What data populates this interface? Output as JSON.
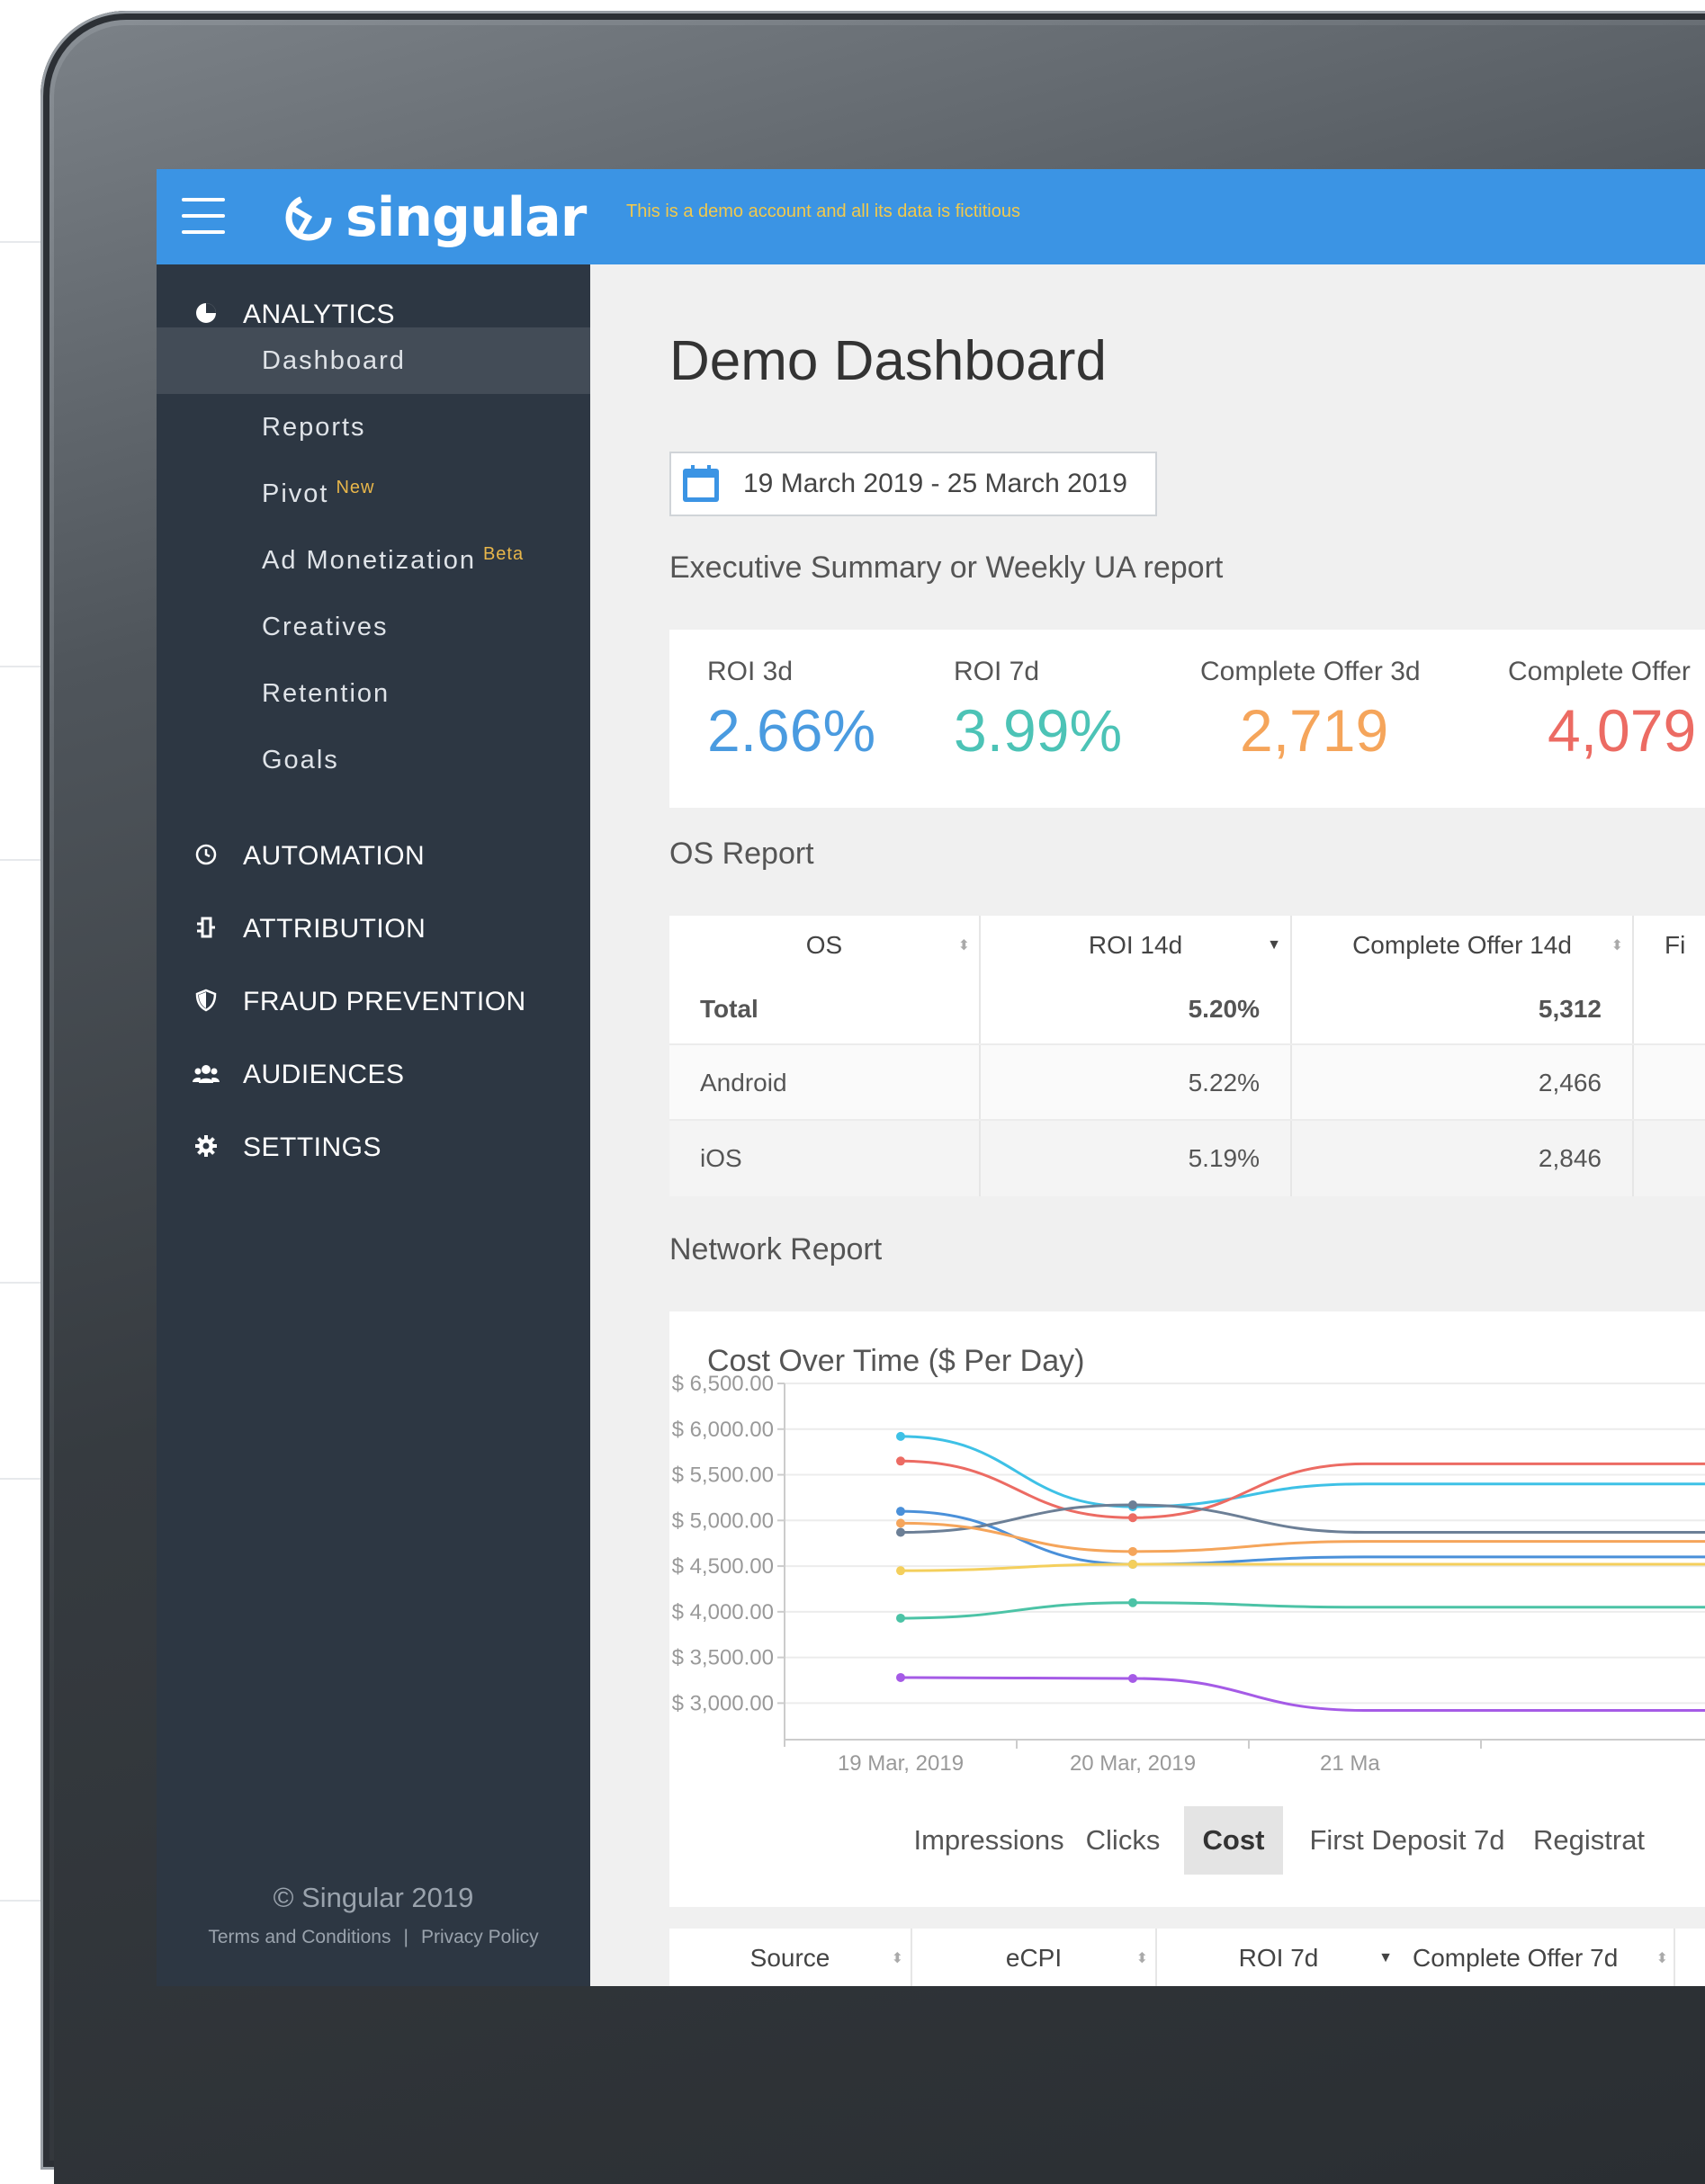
{
  "topbar": {
    "logo_text": "singular",
    "demo_note": "This is a demo account and all its data is fictitious"
  },
  "sidebar": {
    "sections": [
      {
        "label": "ANALYTICS",
        "icon": "pie-chart-icon"
      },
      {
        "label": "AUTOMATION",
        "icon": "clock-icon"
      },
      {
        "label": "ATTRIBUTION",
        "icon": "attribution-icon"
      },
      {
        "label": "FRAUD PREVENTION",
        "icon": "shield-icon"
      },
      {
        "label": "AUDIENCES",
        "icon": "users-icon"
      },
      {
        "label": "SETTINGS",
        "icon": "gear-icon"
      }
    ],
    "analytics_items": [
      {
        "label": "Dashboard",
        "badge": ""
      },
      {
        "label": "Reports",
        "badge": ""
      },
      {
        "label": "Pivot",
        "badge": "New"
      },
      {
        "label": "Ad Monetization",
        "badge": "Beta"
      },
      {
        "label": "Creatives",
        "badge": ""
      },
      {
        "label": "Retention",
        "badge": ""
      },
      {
        "label": "Goals",
        "badge": ""
      }
    ],
    "footer_copy": "© Singular 2019",
    "footer_terms": "Terms and Conditions",
    "footer_separator": "|",
    "footer_privacy": "Privacy Policy"
  },
  "main": {
    "title": "Demo Dashboard",
    "date_range": "19 March 2019 - 25 March 2019",
    "summary_title": "Executive Summary or Weekly UA report",
    "kpis": [
      {
        "label": "ROI 3d",
        "value": "2.66%",
        "color": "#4a9be0"
      },
      {
        "label": "ROI 7d",
        "value": "3.99%",
        "color": "#4cc3b6"
      },
      {
        "label": "Complete Offer 3d",
        "value": "2,719",
        "color": "#f5a55b"
      },
      {
        "label": "Complete Offer",
        "value": "4,079",
        "color": "#ec6b63"
      }
    ],
    "os_report_title": "OS Report",
    "os_table": {
      "headers": [
        "OS",
        "ROI 14d",
        "Complete Offer 14d",
        "Fi"
      ],
      "rows": [
        {
          "os": "Total",
          "roi": "5.20%",
          "offer": "5,312"
        },
        {
          "os": "Android",
          "roi": "5.22%",
          "offer": "2,466"
        },
        {
          "os": "iOS",
          "roi": "5.19%",
          "offer": "2,846"
        }
      ]
    },
    "network_report_title": "Network Report",
    "metric_tabs": [
      "Impressions",
      "Clicks",
      "Cost",
      "First Deposit 7d",
      "Registrat"
    ],
    "active_metric": "Cost",
    "source_table_headers": [
      "Source",
      "eCPI",
      "ROI 7d",
      "Complete Offer 7d"
    ]
  },
  "chart_data": {
    "type": "line",
    "title": "Cost Over Time ($ Per Day)",
    "y_tick_labels": [
      "$ 6,500.00",
      "$ 6,000.00",
      "$ 5,500.00",
      "$ 5,000.00",
      "$ 4,500.00",
      "$ 4,000.00",
      "$ 3,500.00",
      "$ 3,000.00"
    ],
    "y_ticks": [
      6500,
      6000,
      5500,
      5000,
      4500,
      4000,
      3500,
      3000
    ],
    "ylim": [
      2600,
      6500
    ],
    "categories": [
      "19 Mar, 2019",
      "20 Mar, 2019",
      "21 Ma"
    ],
    "series": [
      {
        "color": "#3ec1e6",
        "values": [
          5920,
          5150,
          5400
        ]
      },
      {
        "color": "#ec6b63",
        "values": [
          5650,
          5030,
          5620
        ]
      },
      {
        "color": "#4a90d9",
        "values": [
          5100,
          4520,
          4600
        ]
      },
      {
        "color": "#6c7f96",
        "values": [
          4870,
          5170,
          4870
        ]
      },
      {
        "color": "#f5a55b",
        "values": [
          4970,
          4660,
          4770
        ]
      },
      {
        "color": "#f4cf5c",
        "values": [
          4450,
          4520,
          4520
        ]
      },
      {
        "color": "#4cc3a6",
        "values": [
          3930,
          4100,
          4050
        ]
      },
      {
        "color": "#a55be6",
        "values": [
          3280,
          3270,
          2920
        ]
      }
    ]
  }
}
